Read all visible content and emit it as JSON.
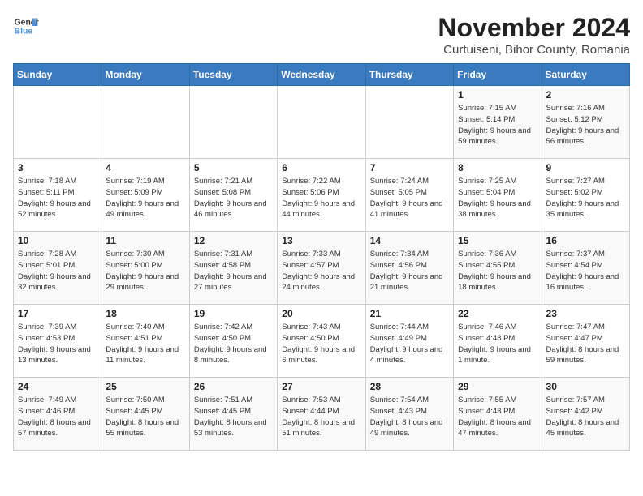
{
  "logo": {
    "line1": "General",
    "line2": "Blue"
  },
  "title": "November 2024",
  "subtitle": "Curtuiseni, Bihor County, Romania",
  "days_of_week": [
    "Sunday",
    "Monday",
    "Tuesday",
    "Wednesday",
    "Thursday",
    "Friday",
    "Saturday"
  ],
  "weeks": [
    [
      {
        "day": "",
        "info": ""
      },
      {
        "day": "",
        "info": ""
      },
      {
        "day": "",
        "info": ""
      },
      {
        "day": "",
        "info": ""
      },
      {
        "day": "",
        "info": ""
      },
      {
        "day": "1",
        "info": "Sunrise: 7:15 AM\nSunset: 5:14 PM\nDaylight: 9 hours and 59 minutes."
      },
      {
        "day": "2",
        "info": "Sunrise: 7:16 AM\nSunset: 5:12 PM\nDaylight: 9 hours and 56 minutes."
      }
    ],
    [
      {
        "day": "3",
        "info": "Sunrise: 7:18 AM\nSunset: 5:11 PM\nDaylight: 9 hours and 52 minutes."
      },
      {
        "day": "4",
        "info": "Sunrise: 7:19 AM\nSunset: 5:09 PM\nDaylight: 9 hours and 49 minutes."
      },
      {
        "day": "5",
        "info": "Sunrise: 7:21 AM\nSunset: 5:08 PM\nDaylight: 9 hours and 46 minutes."
      },
      {
        "day": "6",
        "info": "Sunrise: 7:22 AM\nSunset: 5:06 PM\nDaylight: 9 hours and 44 minutes."
      },
      {
        "day": "7",
        "info": "Sunrise: 7:24 AM\nSunset: 5:05 PM\nDaylight: 9 hours and 41 minutes."
      },
      {
        "day": "8",
        "info": "Sunrise: 7:25 AM\nSunset: 5:04 PM\nDaylight: 9 hours and 38 minutes."
      },
      {
        "day": "9",
        "info": "Sunrise: 7:27 AM\nSunset: 5:02 PM\nDaylight: 9 hours and 35 minutes."
      }
    ],
    [
      {
        "day": "10",
        "info": "Sunrise: 7:28 AM\nSunset: 5:01 PM\nDaylight: 9 hours and 32 minutes."
      },
      {
        "day": "11",
        "info": "Sunrise: 7:30 AM\nSunset: 5:00 PM\nDaylight: 9 hours and 29 minutes."
      },
      {
        "day": "12",
        "info": "Sunrise: 7:31 AM\nSunset: 4:58 PM\nDaylight: 9 hours and 27 minutes."
      },
      {
        "day": "13",
        "info": "Sunrise: 7:33 AM\nSunset: 4:57 PM\nDaylight: 9 hours and 24 minutes."
      },
      {
        "day": "14",
        "info": "Sunrise: 7:34 AM\nSunset: 4:56 PM\nDaylight: 9 hours and 21 minutes."
      },
      {
        "day": "15",
        "info": "Sunrise: 7:36 AM\nSunset: 4:55 PM\nDaylight: 9 hours and 18 minutes."
      },
      {
        "day": "16",
        "info": "Sunrise: 7:37 AM\nSunset: 4:54 PM\nDaylight: 9 hours and 16 minutes."
      }
    ],
    [
      {
        "day": "17",
        "info": "Sunrise: 7:39 AM\nSunset: 4:53 PM\nDaylight: 9 hours and 13 minutes."
      },
      {
        "day": "18",
        "info": "Sunrise: 7:40 AM\nSunset: 4:51 PM\nDaylight: 9 hours and 11 minutes."
      },
      {
        "day": "19",
        "info": "Sunrise: 7:42 AM\nSunset: 4:50 PM\nDaylight: 9 hours and 8 minutes."
      },
      {
        "day": "20",
        "info": "Sunrise: 7:43 AM\nSunset: 4:50 PM\nDaylight: 9 hours and 6 minutes."
      },
      {
        "day": "21",
        "info": "Sunrise: 7:44 AM\nSunset: 4:49 PM\nDaylight: 9 hours and 4 minutes."
      },
      {
        "day": "22",
        "info": "Sunrise: 7:46 AM\nSunset: 4:48 PM\nDaylight: 9 hours and 1 minute."
      },
      {
        "day": "23",
        "info": "Sunrise: 7:47 AM\nSunset: 4:47 PM\nDaylight: 8 hours and 59 minutes."
      }
    ],
    [
      {
        "day": "24",
        "info": "Sunrise: 7:49 AM\nSunset: 4:46 PM\nDaylight: 8 hours and 57 minutes."
      },
      {
        "day": "25",
        "info": "Sunrise: 7:50 AM\nSunset: 4:45 PM\nDaylight: 8 hours and 55 minutes."
      },
      {
        "day": "26",
        "info": "Sunrise: 7:51 AM\nSunset: 4:45 PM\nDaylight: 8 hours and 53 minutes."
      },
      {
        "day": "27",
        "info": "Sunrise: 7:53 AM\nSunset: 4:44 PM\nDaylight: 8 hours and 51 minutes."
      },
      {
        "day": "28",
        "info": "Sunrise: 7:54 AM\nSunset: 4:43 PM\nDaylight: 8 hours and 49 minutes."
      },
      {
        "day": "29",
        "info": "Sunrise: 7:55 AM\nSunset: 4:43 PM\nDaylight: 8 hours and 47 minutes."
      },
      {
        "day": "30",
        "info": "Sunrise: 7:57 AM\nSunset: 4:42 PM\nDaylight: 8 hours and 45 minutes."
      }
    ]
  ]
}
